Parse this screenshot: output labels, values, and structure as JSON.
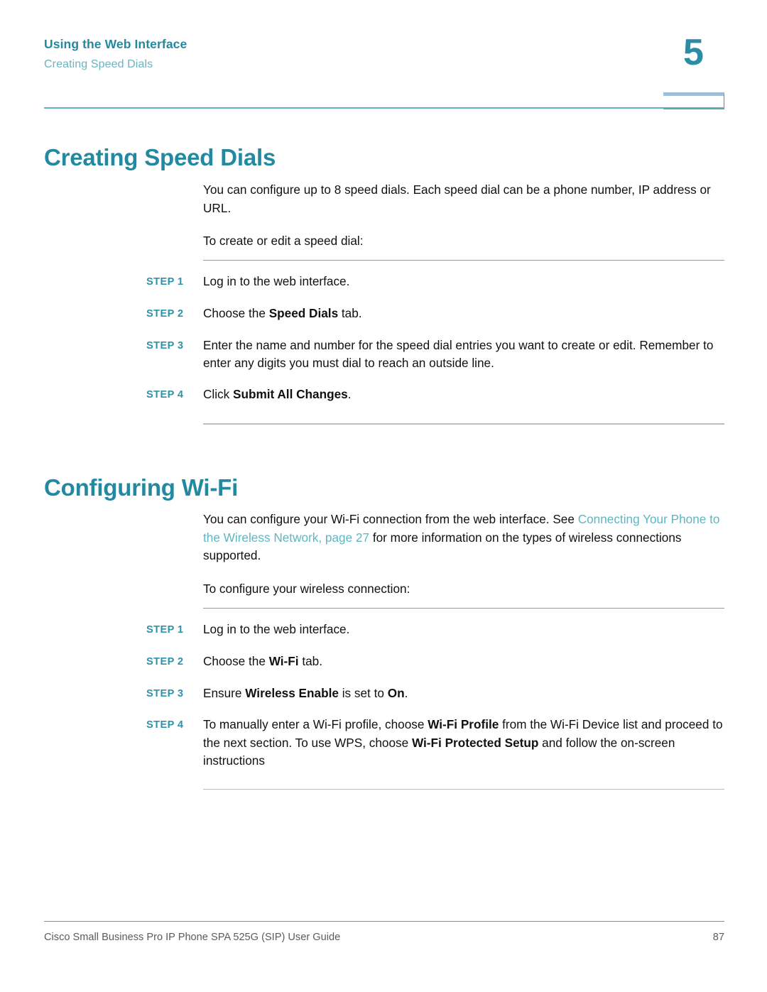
{
  "header": {
    "chapter_title": "Using the Web Interface",
    "section_title": "Creating Speed Dials",
    "chapter_number": "5"
  },
  "sections": [
    {
      "heading": "Creating Speed Dials",
      "paragraphs": [
        "You can configure up to 8 speed dials. Each speed dial can be a phone number, IP address or URL.",
        "To create or edit a speed dial:"
      ],
      "steps": [
        {
          "label": "STEP 1",
          "text_before": "Log in to the web interface.",
          "bold": "",
          "text_after": ""
        },
        {
          "label": "STEP 2",
          "text_before": "Choose the ",
          "bold": "Speed Dials",
          "text_after": " tab."
        },
        {
          "label": "STEP 3",
          "text_before": "Enter the name and number for the speed dial entries you want to create or edit. Remember to enter any digits you must dial to reach an outside line.",
          "bold": "",
          "text_after": ""
        },
        {
          "label": "STEP 4",
          "text_before": "Click ",
          "bold": "Submit All Changes",
          "text_after": "."
        }
      ]
    },
    {
      "heading": "Configuring Wi-Fi",
      "paragraph_1_before": "You can configure your Wi-Fi connection from the web interface. See ",
      "paragraph_1_xref": "Connecting Your Phone to the Wireless Network, page 27",
      "paragraph_1_after": " for more information on the types of wireless connections supported.",
      "paragraph_2": "To configure your wireless connection:",
      "steps": [
        {
          "label": "STEP 1",
          "text_before": "Log in to the web interface.",
          "bold": "",
          "text_after": ""
        },
        {
          "label": "STEP 2",
          "text_before": "Choose the ",
          "bold": "Wi-Fi",
          "text_after": " tab."
        },
        {
          "label": "STEP 3",
          "text_before": "Ensure ",
          "bold": "Wireless Enable",
          "text_after": " is set to ",
          "bold_2": "On",
          "text_after_2": "."
        },
        {
          "label": "STEP 4",
          "text_before": "To manually enter a Wi-Fi profile, choose ",
          "bold": "Wi-Fi Profile",
          "text_after": " from the Wi-Fi Device list and proceed to the next section. To use WPS, choose ",
          "bold_2": "Wi-Fi Protected Setup",
          "text_after_2": " and follow the on-screen instructions"
        }
      ]
    }
  ],
  "footer": {
    "document_title": "Cisco Small Business Pro IP Phone SPA 525G (SIP) User Guide",
    "page_number": "87"
  },
  "colors": {
    "heading_teal": "#2389a1",
    "subtitle_teal": "#6cb3bf",
    "step_label_teal": "#2e92a8",
    "xref_teal": "#5fb6c3",
    "rule_grey": "#9a9a9a"
  }
}
